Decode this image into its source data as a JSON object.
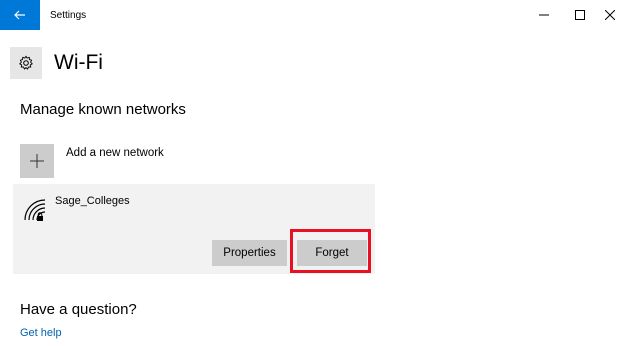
{
  "titlebar": {
    "app_title": "Settings",
    "back_icon": "arrow-left-icon",
    "accent_color": "#0078d7",
    "minimize_glyph": "–",
    "maximize_glyph": "☐",
    "close_glyph": "✕"
  },
  "header": {
    "icon": "gear-icon",
    "title": "Wi-Fi"
  },
  "manage": {
    "section_title": "Manage known networks",
    "add_network_label": "Add a new network",
    "plus_glyph": "+",
    "networks": [
      {
        "name": "Sage_Colleges",
        "icon": "wifi-secure-icon",
        "properties_label": "Properties",
        "forget_label": "Forget"
      }
    ]
  },
  "question": {
    "section_title": "Have a question?",
    "link_label": "Get help",
    "link_color": "#0063b1"
  },
  "highlight_color": "#e81123"
}
